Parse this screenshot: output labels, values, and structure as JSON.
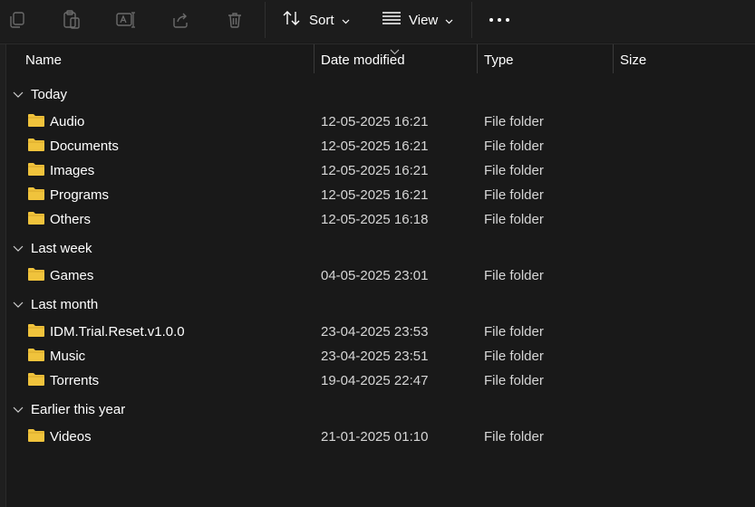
{
  "toolbar": {
    "sort_label": "Sort",
    "view_label": "View",
    "icons": [
      "copy-icon",
      "paste-icon",
      "rename-icon",
      "share-icon",
      "delete-icon",
      "sort-icon",
      "view-icon",
      "more-icon"
    ]
  },
  "columns": {
    "name": "Name",
    "date": "Date modified",
    "type": "Type",
    "size": "Size"
  },
  "groups": [
    {
      "label": "Today",
      "items": [
        {
          "name": "Audio",
          "date": "12-05-2025 16:21",
          "type": "File folder"
        },
        {
          "name": "Documents",
          "date": "12-05-2025 16:21",
          "type": "File folder"
        },
        {
          "name": "Images",
          "date": "12-05-2025 16:21",
          "type": "File folder"
        },
        {
          "name": "Programs",
          "date": "12-05-2025 16:21",
          "type": "File folder"
        },
        {
          "name": "Others",
          "date": "12-05-2025 16:18",
          "type": "File folder"
        }
      ]
    },
    {
      "label": "Last week",
      "items": [
        {
          "name": "Games",
          "date": "04-05-2025 23:01",
          "type": "File folder"
        }
      ]
    },
    {
      "label": "Last month",
      "items": [
        {
          "name": "IDM.Trial.Reset.v1.0.0",
          "date": "23-04-2025 23:53",
          "type": "File folder"
        },
        {
          "name": "Music",
          "date": "23-04-2025 23:51",
          "type": "File folder"
        },
        {
          "name": "Torrents",
          "date": "19-04-2025 22:47",
          "type": "File folder"
        }
      ]
    },
    {
      "label": "Earlier this year",
      "items": [
        {
          "name": "Videos",
          "date": "21-01-2025 01:10",
          "type": "File folder"
        }
      ]
    }
  ],
  "colors": {
    "background": "#191919",
    "folder": "#f0c33c",
    "text": "#ffffff"
  }
}
